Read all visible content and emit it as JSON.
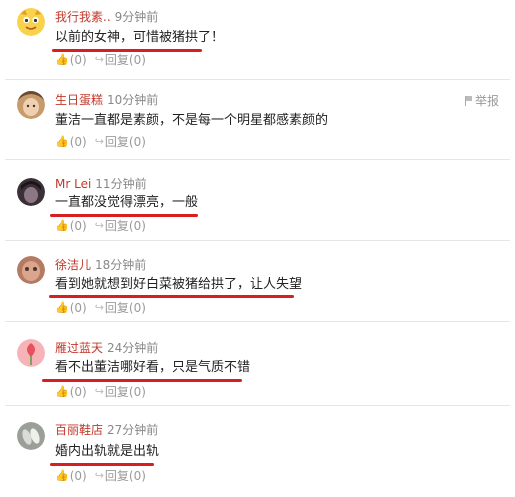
{
  "comments": [
    {
      "username": "我行我素..",
      "time": "9分钟前",
      "text": "以前的女神，可惜被猪拱了！",
      "likes": "(0)",
      "reply": "回复(0)",
      "avatar_colors": [
        "#f7d24a",
        "#e39b23"
      ]
    },
    {
      "username": "生日蛋糕",
      "time": "10分钟前",
      "text": "董洁一直都是素颜，不是每一个明星都感素颜的",
      "likes": "(0)",
      "reply": "回复(0)",
      "report": "举报",
      "avatar_colors": [
        "#c89b6a",
        "#6b4a34"
      ]
    },
    {
      "username": "Mr Lei",
      "time": "11分钟前",
      "text": "一直都没觉得漂亮，一般",
      "likes": "(0)",
      "reply": "回复(0)",
      "avatar_colors": [
        "#3a3036",
        "#8c7884"
      ]
    },
    {
      "username": "徐洁儿",
      "time": "18分钟前",
      "text": "看到她就想到好白菜被猪给拱了，让人失望",
      "likes": "(0)",
      "reply": "回复(0)",
      "avatar_colors": [
        "#b47a62",
        "#4d332b"
      ]
    },
    {
      "username": "雁过蓝天",
      "time": "24分钟前",
      "text": "看不出董洁哪好看，只是气质不错",
      "likes": "(0)",
      "reply": "回复(0)",
      "avatar_colors": [
        "#e8505b",
        "#f7b4b8"
      ]
    },
    {
      "username": "百丽鞋店",
      "time": "27分钟前",
      "text": "婚内出轨就是出轨",
      "likes": "(0)",
      "reply": "回复(0)",
      "avatar_colors": [
        "#9aa098",
        "#d9dcd7"
      ]
    }
  ],
  "highlight_color": "#d81e1e",
  "username_color": "#c0392b",
  "icons": {
    "like": "thumbs-up-icon",
    "reply": "reply-arrow-icon",
    "report": "flag-icon"
  }
}
